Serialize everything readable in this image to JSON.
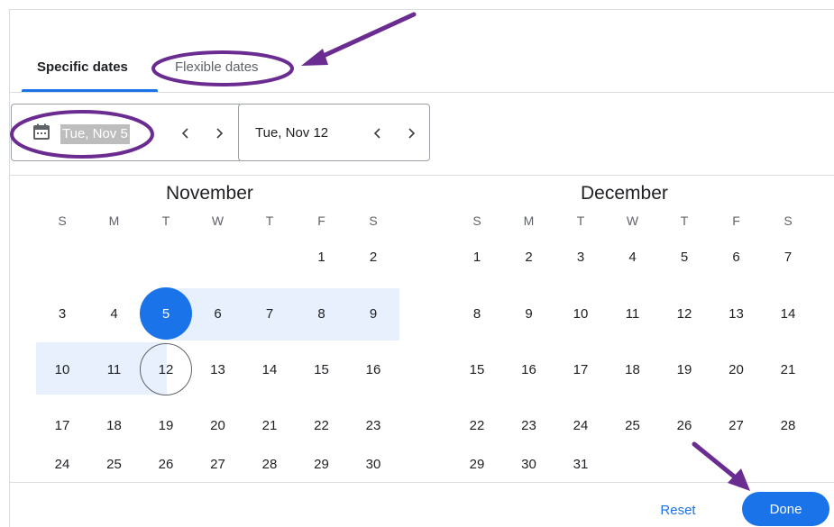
{
  "tabs": [
    {
      "label": "Specific dates",
      "active": true
    },
    {
      "label": "Flexible dates",
      "active": false
    }
  ],
  "date_range": {
    "start": "Tue, Nov 5",
    "end": "Tue, Nov 12"
  },
  "months": [
    {
      "title": "November",
      "weekdays": [
        "S",
        "M",
        "T",
        "W",
        "T",
        "F",
        "S"
      ],
      "rows": [
        [
          "",
          "",
          "",
          "",
          "",
          "1",
          "2"
        ],
        [
          "3",
          "4",
          "5",
          "6",
          "7",
          "8",
          "9"
        ],
        [
          "10",
          "11",
          "12",
          "13",
          "14",
          "15",
          "16"
        ],
        [
          "17",
          "18",
          "19",
          "20",
          "21",
          "22",
          "23"
        ],
        [
          "24",
          "25",
          "26",
          "27",
          "28",
          "29",
          "30"
        ]
      ]
    },
    {
      "title": "December",
      "weekdays": [
        "S",
        "M",
        "T",
        "W",
        "T",
        "F",
        "S"
      ],
      "rows": [
        [
          "1",
          "2",
          "3",
          "4",
          "5",
          "6",
          "7"
        ],
        [
          "8",
          "9",
          "10",
          "11",
          "12",
          "13",
          "14"
        ],
        [
          "15",
          "16",
          "17",
          "18",
          "19",
          "20",
          "21"
        ],
        [
          "22",
          "23",
          "24",
          "25",
          "26",
          "27",
          "28"
        ],
        [
          "29",
          "30",
          "31",
          "",
          "",
          "",
          ""
        ]
      ]
    }
  ],
  "selection": {
    "start_day": "5",
    "end_day": "12"
  },
  "footer": {
    "reset_label": "Reset",
    "done_label": "Done"
  },
  "colors": {
    "accent": "#1a73e8",
    "range_fill": "#e8f0fe",
    "annotation": "#6a2c91"
  }
}
